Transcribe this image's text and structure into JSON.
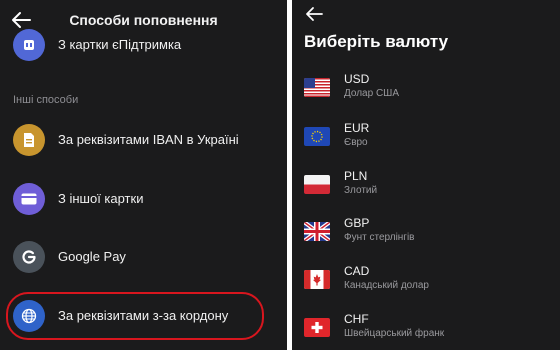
{
  "left": {
    "title": "Способи поповнення",
    "top_item_label": "З картки єПідтримка",
    "section_label": "Інші способи",
    "methods": [
      {
        "label": "За реквізитами IBAN в Україні",
        "icon": "document-icon",
        "color": "#c8952e"
      },
      {
        "label": "З іншої картки",
        "icon": "card-icon",
        "color": "#6f5ed7"
      },
      {
        "label": "Google Pay",
        "icon": "google-icon",
        "color": "#4a525a"
      },
      {
        "label": "За реквізитами з-за кордону",
        "icon": "globe-icon",
        "color": "#2f63c9"
      }
    ],
    "highlight_color": "#d8161e"
  },
  "right": {
    "title": "Виберіть валюту",
    "currencies": [
      {
        "code": "USD",
        "name": "Долар США",
        "flag": "us-flag-icon"
      },
      {
        "code": "EUR",
        "name": "Євро",
        "flag": "eu-flag-icon"
      },
      {
        "code": "PLN",
        "name": "Злотий",
        "flag": "pl-flag-icon"
      },
      {
        "code": "GBP",
        "name": "Фунт стерлінгів",
        "flag": "gb-flag-icon"
      },
      {
        "code": "CAD",
        "name": "Канадський долар",
        "flag": "ca-flag-icon"
      },
      {
        "code": "CHF",
        "name": "Швейцарський франк",
        "flag": "ch-flag-icon"
      }
    ]
  }
}
